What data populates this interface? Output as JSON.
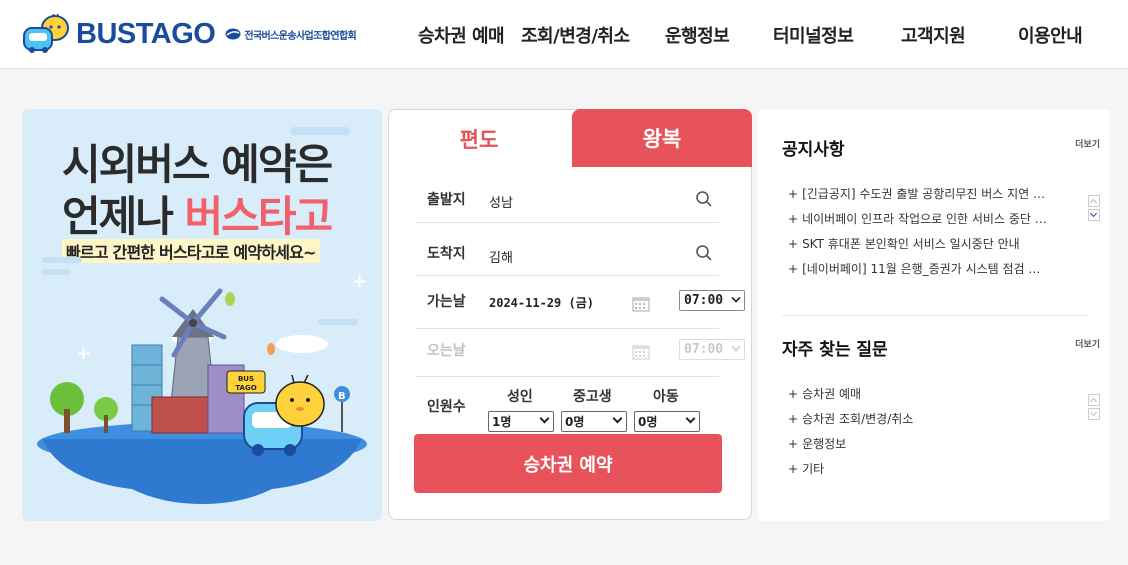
{
  "header": {
    "logo_text": "BUSTAGO",
    "association": "전국버스운송사업조합연합회",
    "nav": [
      "승차권 예매",
      "조회/변경/취소",
      "운행정보",
      "터미널정보",
      "고객지원",
      "이용안내"
    ]
  },
  "banner": {
    "line1": "시외버스 예약은",
    "line2_prefix": "언제나 ",
    "line2_highlight": "버스타고",
    "subtitle": "빠르고 간편한 버스타고로 예약하세요~",
    "bus_sign": "BUS TAGO"
  },
  "booking": {
    "tab_oneway": "편도",
    "tab_round": "왕복",
    "departure_label": "출발지",
    "departure_value": "성남",
    "arrival_label": "도착지",
    "arrival_value": "김해",
    "go_label": "가는날",
    "go_date": "2024-11-29 (금)",
    "go_time": "07:00",
    "return_label": "오는날",
    "return_time": "07:00",
    "passenger_label": "인원수",
    "passengers": [
      {
        "type": "성인",
        "value": "1명"
      },
      {
        "type": "중고생",
        "value": "0명"
      },
      {
        "type": "아동",
        "value": "0명"
      }
    ],
    "reserve_button": "승차권 예약"
  },
  "notices": {
    "title": "공지사항",
    "more": "더보기",
    "items": [
      "[긴급공지] 수도권 출발 공항리무진 버스 지연 …",
      "네이버페이 인프라 작업으로 인한 서비스 중단 …",
      "SKT 휴대폰 본인확인 서비스 일시중단 안내",
      "[네이버페이] 11월 은행_증권가 시스템 점검 …"
    ]
  },
  "faq": {
    "title": "자주 찾는 질문",
    "more": "더보기",
    "items": [
      "승차권 예매",
      "승차권 조회/변경/취소",
      "운행정보",
      "기타"
    ]
  },
  "colors": {
    "brand": "#1a4b9c",
    "accent": "#e8525a",
    "banner_bg": "#d9ecfa"
  }
}
